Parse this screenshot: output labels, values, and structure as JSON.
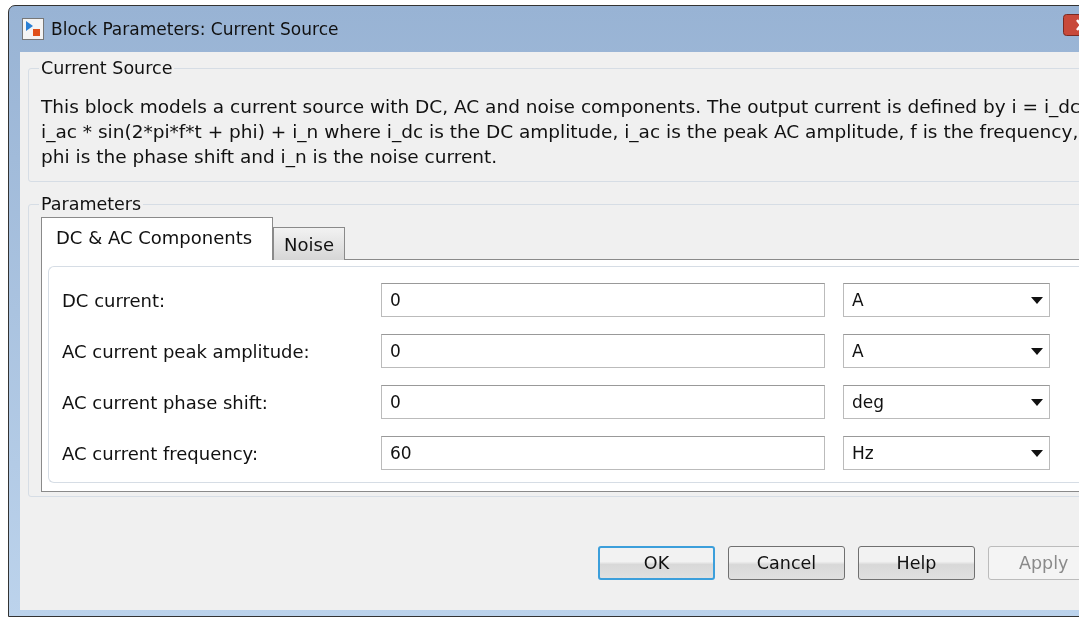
{
  "window": {
    "title": "Block Parameters: Current Source"
  },
  "description_group": {
    "title": "Current Source",
    "lines": [
      "This block models a current source with DC, AC and noise components. The output current is defined by i = i_dc",
      "i_ac * sin(2*pi*f*t + phi) + i_n where i_dc is the DC amplitude, i_ac is the peak AC amplitude, f is the frequency,",
      "phi is the phase shift and i_n is the noise current."
    ]
  },
  "parameters_group": {
    "title": "Parameters",
    "tabs": [
      {
        "label": "DC & AC Components",
        "selected": true
      },
      {
        "label": "Noise",
        "selected": false
      }
    ],
    "fields": [
      {
        "label": "DC current:",
        "value": "0",
        "unit": "A"
      },
      {
        "label": "AC current peak amplitude:",
        "value": "0",
        "unit": "A"
      },
      {
        "label": "AC current phase shift:",
        "value": "0",
        "unit": "deg"
      },
      {
        "label": "AC current frequency:",
        "value": "60",
        "unit": "Hz"
      }
    ]
  },
  "buttons": [
    {
      "label": "OK",
      "default": true,
      "disabled": false
    },
    {
      "label": "Cancel",
      "default": false,
      "disabled": false
    },
    {
      "label": "Help",
      "default": false,
      "disabled": false
    },
    {
      "label": "Apply",
      "default": false,
      "disabled": true
    }
  ]
}
